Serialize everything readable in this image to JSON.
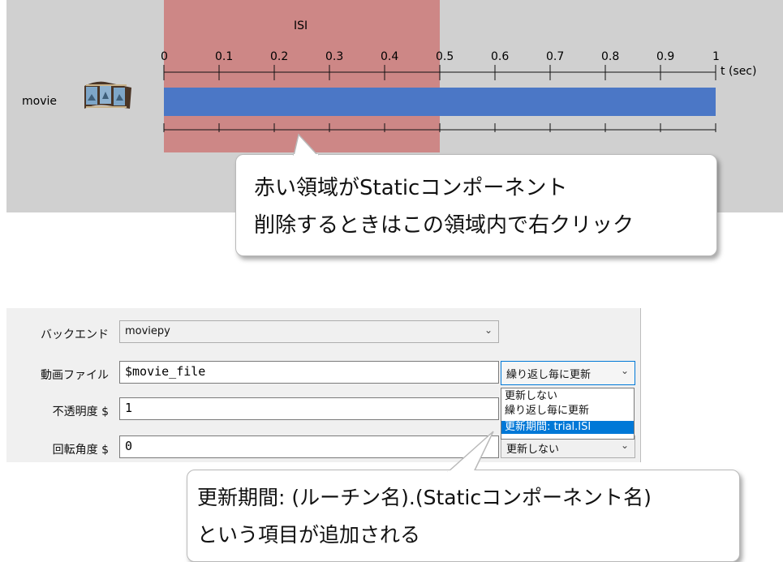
{
  "timeline": {
    "component_name": "movie",
    "static_region_label": "ISI",
    "time_unit": "t (sec)",
    "ticks": [
      "0",
      "0.1",
      "0.2",
      "0.3",
      "0.4",
      "0.5",
      "0.6",
      "0.7",
      "0.8",
      "0.9",
      "1"
    ],
    "static_start": 0,
    "static_end": 0.5,
    "movie_start": 0,
    "movie_end": 1,
    "colors": {
      "static_region": "#cd8786",
      "movie_bar": "#4b77c6",
      "background": "#d0d0d0"
    }
  },
  "callout_top": {
    "line1": "赤い領域がStaticコンポーネント",
    "line2": "削除するときはこの領域内で右クリック"
  },
  "dialog": {
    "backend_label": "バックエンド",
    "backend_value": "moviepy",
    "movie_file_label": "動画ファイル",
    "movie_file_value": "$movie_file",
    "movie_file_update": "繰り返し毎に更新",
    "opacity_label": "不透明度 $",
    "opacity_value": "1",
    "rotation_label": "回転角度 $",
    "rotation_value": "0",
    "rotation_update": "更新しない",
    "update_options": [
      "更新しない",
      "繰り返し毎に更新",
      "更新期間: trial.ISI"
    ],
    "selected_option_index": 2
  },
  "callout_bottom": {
    "line1": "更新期間: (ルーチン名).(Staticコンポーネント名)",
    "line2": "という項目が追加される"
  },
  "icons": {
    "film": "film-strip-icon",
    "chevron": "chevron-down-icon"
  }
}
